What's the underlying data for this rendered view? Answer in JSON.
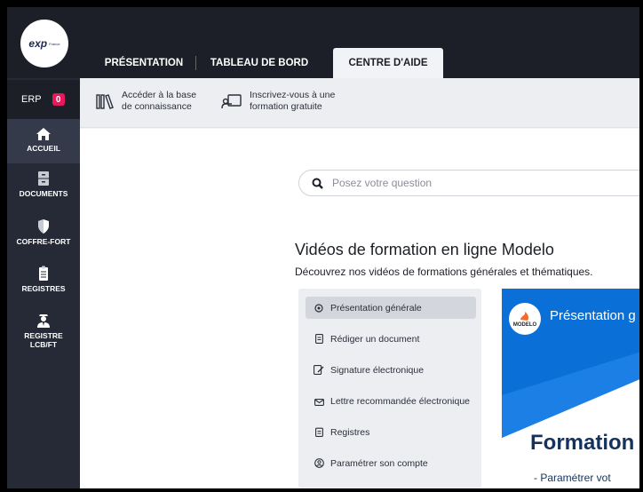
{
  "brand": {
    "logo_text": "exp",
    "logo_sub": "France"
  },
  "sidebar": {
    "erp_label": "ERP",
    "erp_badge": "0",
    "items": [
      {
        "label": "ACCUEIL",
        "icon": "home-icon"
      },
      {
        "label": "DOCUMENTS",
        "icon": "file-cabinet-icon"
      },
      {
        "label": "COFFRE-FORT",
        "icon": "shield-icon"
      },
      {
        "label": "REGISTRES",
        "icon": "clipboard-icon"
      },
      {
        "label": "REGISTRE LCB/FT",
        "icon": "agent-icon"
      }
    ]
  },
  "tabs": [
    {
      "label": "PRÉSENTATION"
    },
    {
      "label": "TABLEAU DE BORD"
    },
    {
      "label": "CENTRE D'AIDE"
    }
  ],
  "subbar": {
    "knowledge_link": "Accéder à la base de connaissance",
    "training_link": "Inscrivez-vous à une formation gratuite"
  },
  "search": {
    "placeholder": "Posez votre question"
  },
  "section": {
    "title": "Vidéos de formation en ligne Modelo",
    "subtitle": "Découvrez nos vidéos de formations générales et thématiques."
  },
  "videos": [
    {
      "label": "Présentation générale",
      "icon": "pin-icon"
    },
    {
      "label": "Rédiger un document",
      "icon": "document-icon"
    },
    {
      "label": "Signature électronique",
      "icon": "signature-icon"
    },
    {
      "label": "Lettre recommandée électronique",
      "icon": "mail-icon"
    },
    {
      "label": "Registres",
      "icon": "clipboard-icon"
    },
    {
      "label": "Paramétrer son compte",
      "icon": "user-circle-icon"
    }
  ],
  "player": {
    "badge": "MODELO",
    "title": "Présentation g",
    "big_text": "Formation",
    "sub_text": "- Paramétrer vot"
  },
  "colors": {
    "sidebar_bg": "#252a36",
    "topbar_bg": "#1c1f27",
    "badge": "#e8185c",
    "video_blue": "#0a6fd6"
  }
}
